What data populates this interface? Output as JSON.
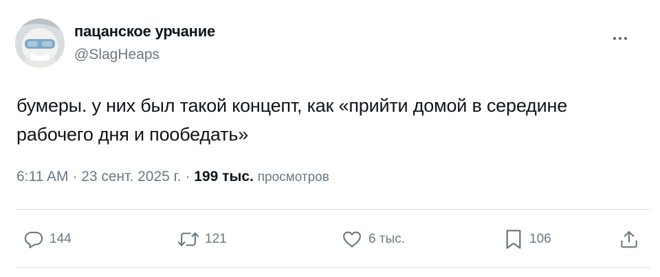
{
  "author": {
    "display_name": "пацанское урчание",
    "handle": "@SlagHeaps"
  },
  "tweet": {
    "text_line_1": "бумеры. у них был такой концепт, как «прийти домой в середине",
    "text_line_2": "рабочего дня и пообедать»",
    "time": "6:11 AM",
    "separator": "·",
    "date": "23 сент. 2025 г.",
    "views_count": "199 тыс.",
    "views_label": "просмотров"
  },
  "actions": {
    "replies": "144",
    "reposts": "121",
    "likes": "6 тыс.",
    "bookmarks": "106"
  },
  "icons": {
    "reply": "reply-icon",
    "repost": "repost-icon",
    "like": "heart-icon",
    "bookmark": "bookmark-icon",
    "share": "share-icon",
    "more": "more-icon"
  },
  "colors": {
    "text": "#0f1419",
    "secondary": "#6b7781",
    "divider": "#dbe0e4"
  }
}
